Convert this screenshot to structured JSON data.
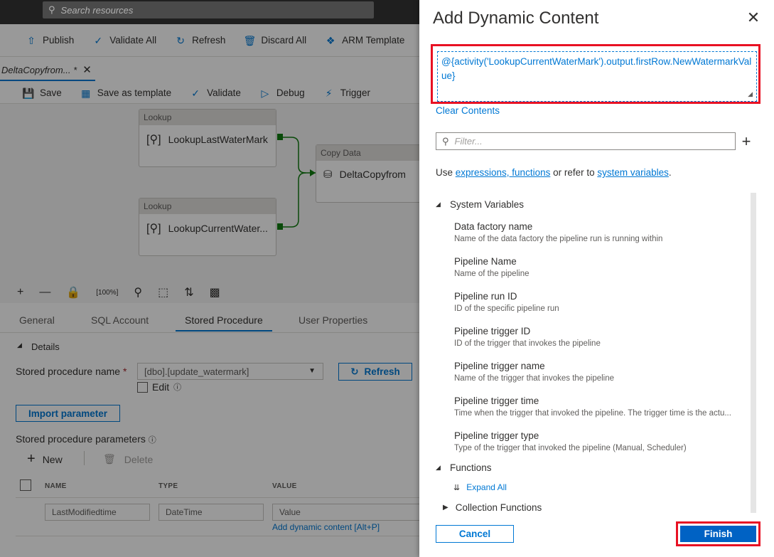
{
  "topbar": {
    "search_placeholder": "Search resources"
  },
  "command_bar": {
    "publish": "Publish",
    "validate_all": "Validate All",
    "refresh": "Refresh",
    "discard_all": "Discard All",
    "arm_template": "ARM Template"
  },
  "document_tab": {
    "label": "DeltaCopyfrom... *"
  },
  "pipeline_toolbar": {
    "save": "Save",
    "save_as_template": "Save as template",
    "validate": "Validate",
    "debug": "Debug",
    "trigger": "Trigger"
  },
  "canvas": {
    "activities": [
      {
        "type": "Lookup",
        "name": "LookupLastWaterMark"
      },
      {
        "type": "Lookup",
        "name": "LookupCurrentWater..."
      },
      {
        "type": "Copy Data",
        "name": "DeltaCopyfrom"
      }
    ]
  },
  "props": {
    "tabs": [
      "General",
      "SQL Account",
      "Stored Procedure",
      "User Properties"
    ],
    "details_label": "Details",
    "sp_name_label": "Stored procedure name",
    "sp_name_value": "[dbo].[update_watermark]",
    "refresh_label": "Refresh",
    "edit_label": "Edit",
    "import_parameter": "Import parameter",
    "params_label": "Stored procedure parameters",
    "new_label": "New",
    "delete_label": "Delete",
    "columns": [
      "NAME",
      "TYPE",
      "VALUE"
    ],
    "row": {
      "name": "LastModifiedtime",
      "type": "DateTime",
      "value_placeholder": "Value"
    },
    "add_dynamic": "Add dynamic content [Alt+P]"
  },
  "panel": {
    "title": "Add Dynamic Content",
    "expression": "@{activity('LookupCurrentWaterMark').output.firstRow.NewWatermarkValue}",
    "clear_contents": "Clear Contents",
    "filter_placeholder": "Filter...",
    "use_prefix": "Use ",
    "use_link1": "expressions, functions",
    "use_middle": " or refer to ",
    "use_link2": "system variables",
    "use_suffix": ".",
    "system_variables_label": "System Variables",
    "variables": [
      {
        "name": "Data factory name",
        "desc": "Name of the data factory the pipeline run is running within"
      },
      {
        "name": "Pipeline Name",
        "desc": "Name of the pipeline"
      },
      {
        "name": "Pipeline run ID",
        "desc": "ID of the specific pipeline run"
      },
      {
        "name": "Pipeline trigger ID",
        "desc": "ID of the trigger that invokes the pipeline"
      },
      {
        "name": "Pipeline trigger name",
        "desc": "Name of the trigger that invokes the pipeline"
      },
      {
        "name": "Pipeline trigger time",
        "desc": "Time when the trigger that invoked the pipeline. The trigger time is the actu..."
      },
      {
        "name": "Pipeline trigger type",
        "desc": "Type of the trigger that invoked the pipeline (Manual, Scheduler)"
      }
    ],
    "functions_label": "Functions",
    "expand_all": "Expand All",
    "collection_functions": "Collection Functions",
    "cancel": "Cancel",
    "finish": "Finish"
  }
}
